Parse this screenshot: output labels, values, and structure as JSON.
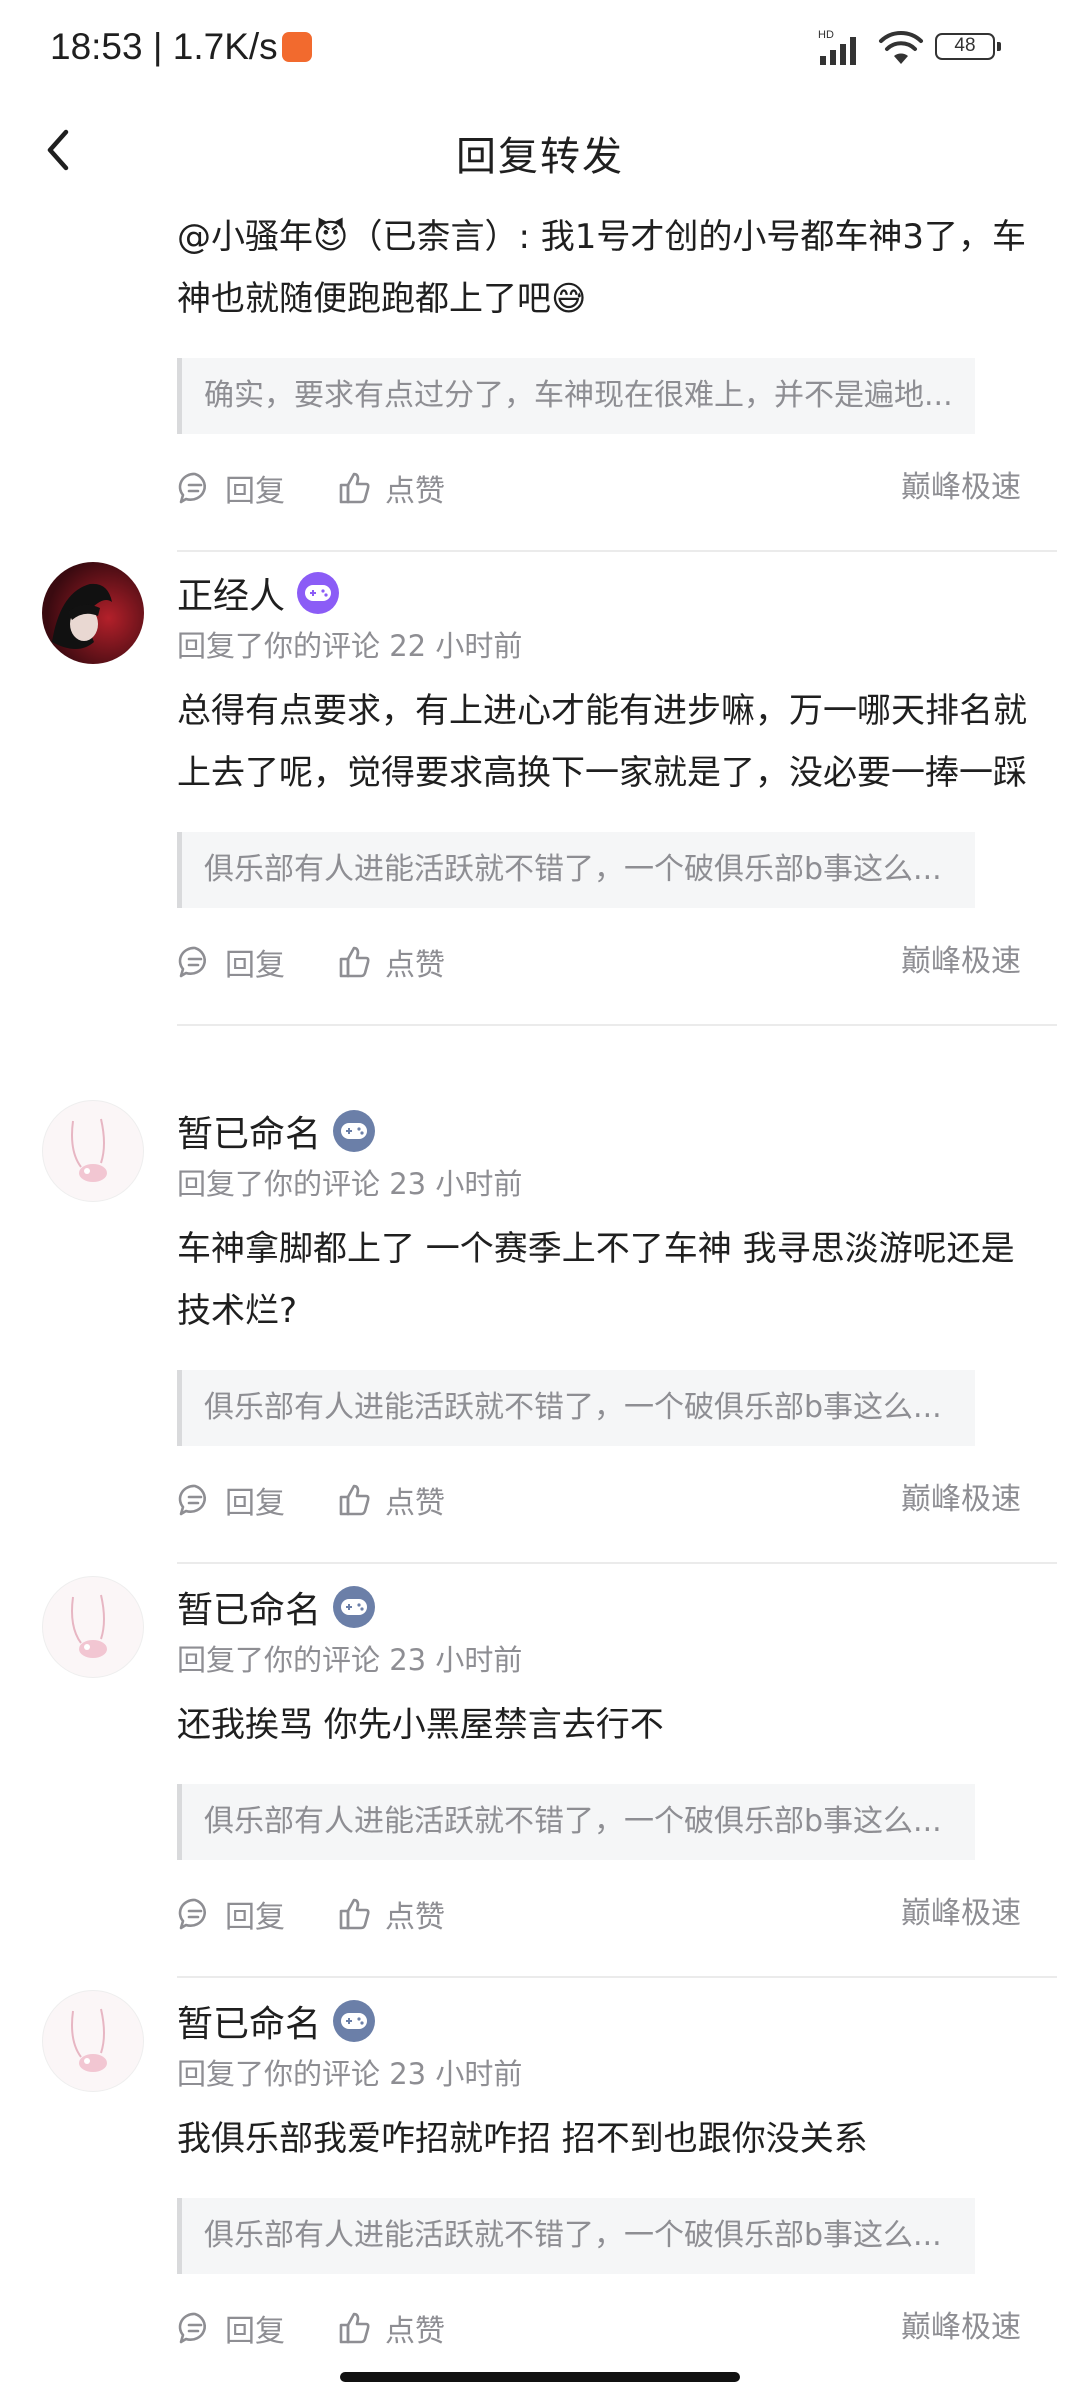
{
  "status_bar": {
    "time": "18:53 | 1.7K/s",
    "network": "HD",
    "battery": "48"
  },
  "header": {
    "title": "回复转发"
  },
  "first_item": {
    "content": "@小骚年😈（已柰言）: 我1号才创的小号都车神3了，车神也就随便跑跑都上了吧😅",
    "quote": "确实，要求有点过分了，车神现在很难上，并不是遍地...",
    "reply_label": "回复",
    "like_label": "点赞",
    "source": "巅峰极速"
  },
  "comments": [
    {
      "name": "正经人",
      "badge_color": "#8b5cf6",
      "meta": "回复了你的评论 22 小时前",
      "content": "总得有点要求，有上进心才能有进步嘛，万一哪天排名就上去了呢，觉得要求高换下一家就是了，没必要一捧一踩",
      "quote": "俱乐部有人进能活跃就不错了，一个破俱乐部b事这么...",
      "reply_label": "回复",
      "like_label": "点赞",
      "source": "巅峰极速"
    },
    {
      "name": "暂已命名",
      "badge_color": "#6b7fa8",
      "meta": "回复了你的评论 23 小时前",
      "content": "车神拿脚都上了 一个赛季上不了车神 我寻思淡游呢还是技术烂?",
      "quote": "俱乐部有人进能活跃就不错了，一个破俱乐部b事这么...",
      "reply_label": "回复",
      "like_label": "点赞",
      "source": "巅峰极速"
    },
    {
      "name": "暂已命名",
      "badge_color": "#6b7fa8",
      "meta": "回复了你的评论 23 小时前",
      "content": "还我挨骂 你先小黑屋禁言去行不",
      "quote": "俱乐部有人进能活跃就不错了，一个破俱乐部b事这么...",
      "reply_label": "回复",
      "like_label": "点赞",
      "source": "巅峰极速"
    },
    {
      "name": "暂已命名",
      "badge_color": "#6b7fa8",
      "meta": "回复了你的评论 23 小时前",
      "content": "我俱乐部我爱咋招就咋招 招不到也跟你没关系",
      "quote": "俱乐部有人进能活跃就不错了，一个破俱乐部b事这么...",
      "reply_label": "回复",
      "like_label": "点赞",
      "source": "巅峰极速"
    }
  ]
}
